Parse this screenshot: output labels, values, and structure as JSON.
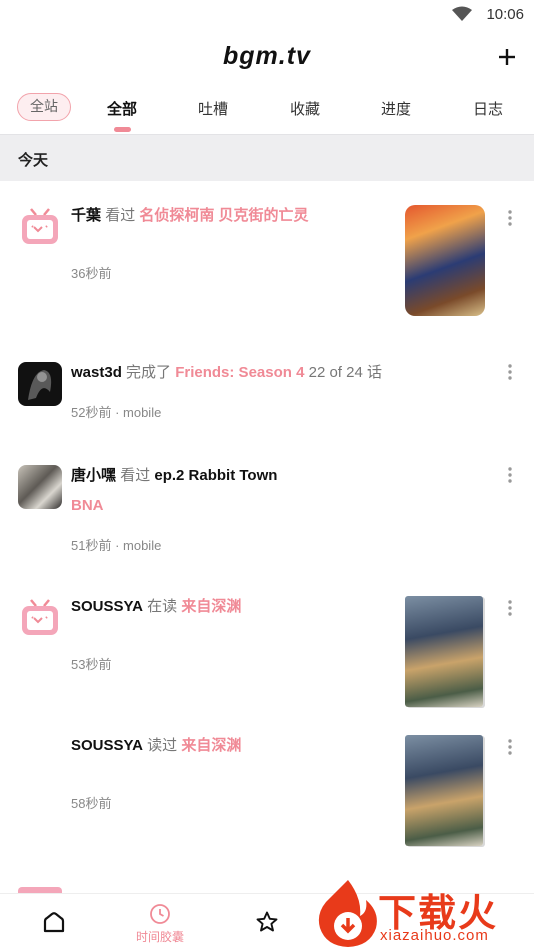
{
  "status": {
    "time": "10:06",
    "wifi_icon": "wifi-icon"
  },
  "app": {
    "title": "bgm.tv",
    "add_icon": "plus-icon"
  },
  "tabs": {
    "scope": "全站",
    "items": [
      {
        "label": "全部",
        "active": true
      },
      {
        "label": "吐槽",
        "active": false
      },
      {
        "label": "收藏",
        "active": false
      },
      {
        "label": "进度",
        "active": false
      },
      {
        "label": "日志",
        "active": false
      }
    ]
  },
  "section": {
    "title": "今天"
  },
  "feed": [
    {
      "user": "千葉",
      "action": "看过",
      "subject": "名侦探柯南 贝克街的亡灵",
      "time": "36秒前"
    },
    {
      "user": "wast3d",
      "action": "完成了",
      "subject": "Friends: Season 4",
      "extra": "22 of 24 话",
      "time": "52秒前 · mobile"
    },
    {
      "user": "唐小嘿",
      "action": "看过",
      "episode": "ep.2 Rabbit Town",
      "subject": "BNA",
      "time": "51秒前 · mobile"
    },
    {
      "user": "SOUSSYA",
      "action": "在读",
      "subject": "来自深渊",
      "time": "53秒前"
    },
    {
      "user": "SOUSSYA",
      "action": "读过",
      "subject": "来自深渊",
      "time": "58秒前"
    }
  ],
  "bottom_nav": [
    {
      "icon": "home-icon",
      "label": ""
    },
    {
      "icon": "clock-icon",
      "label": "时间胶囊"
    },
    {
      "icon": "star-icon",
      "label": ""
    }
  ],
  "watermark": {
    "text": "下载火",
    "sub": "xiazaihuo.com"
  },
  "colors": {
    "accent": "#f08a96",
    "chip_bg": "#fdeef0",
    "section_bg": "#eeeef0",
    "watermark": "#e83a1a"
  }
}
